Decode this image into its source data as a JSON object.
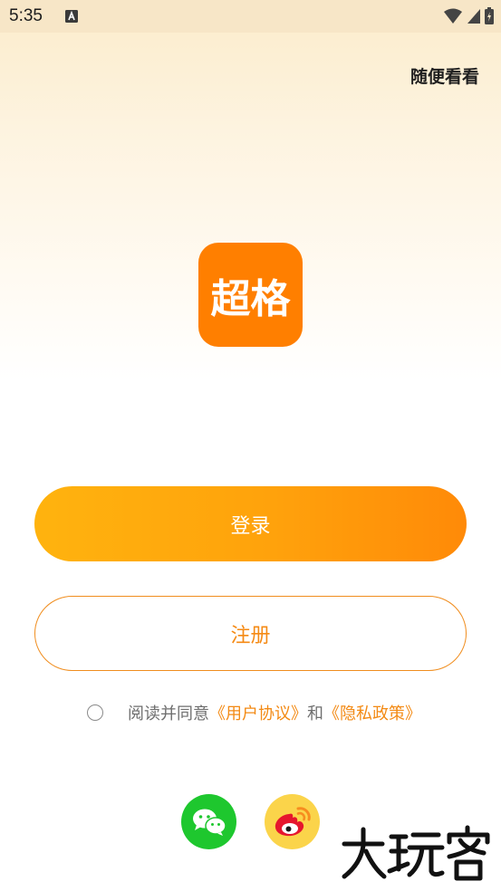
{
  "status_bar": {
    "time": "5:35",
    "icons": [
      "a-notification-icon",
      "wifi-icon",
      "signal-icon",
      "battery-icon"
    ]
  },
  "header": {
    "browse_label": "随便看看"
  },
  "logo": {
    "text": "超格",
    "color": "#ff7f00"
  },
  "buttons": {
    "login_label": "登录",
    "register_label": "注册"
  },
  "agreement": {
    "prefix": "阅读并同意",
    "user_agreement": "《用户协议》",
    "conjunction": "和",
    "privacy_policy": "《隐私政策》"
  },
  "social": {
    "icons": [
      "wechat-icon",
      "weibo-icon"
    ]
  },
  "watermark": {
    "text": "大玩客"
  },
  "colors": {
    "accent": "#ff8a08",
    "link": "#f38a14",
    "wechat": "#1ec72e",
    "weibo": "#fbd44a"
  }
}
